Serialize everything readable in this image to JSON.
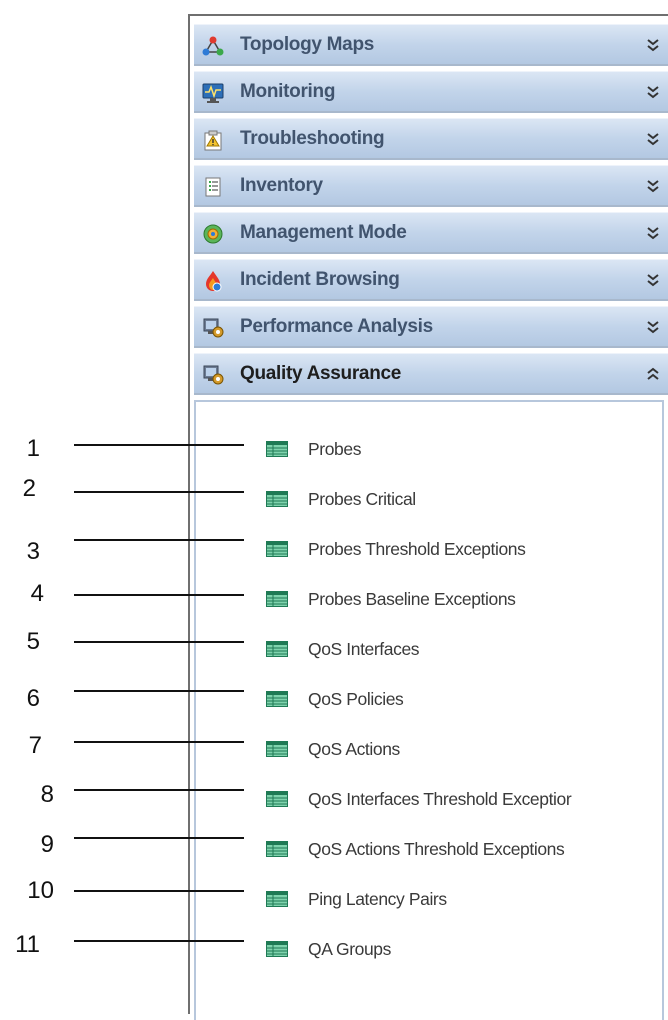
{
  "panel": {
    "headers": [
      {
        "label": "Topology Maps",
        "icon": "topology-icon"
      },
      {
        "label": "Monitoring",
        "icon": "monitor-icon"
      },
      {
        "label": "Troubleshooting",
        "icon": "troubleshooting-icon"
      },
      {
        "label": "Inventory",
        "icon": "inventory-icon"
      },
      {
        "label": "Management Mode",
        "icon": "management-mode-icon"
      },
      {
        "label": "Incident Browsing",
        "icon": "incident-icon"
      },
      {
        "label": "Performance Analysis",
        "icon": "performance-icon"
      },
      {
        "label": "Quality Assurance",
        "icon": "quality-assurance-icon",
        "expanded": true
      }
    ],
    "items": [
      {
        "label": "Probes"
      },
      {
        "label": "Probes Critical"
      },
      {
        "label": "Probes Threshold Exceptions"
      },
      {
        "label": "Probes Baseline Exceptions"
      },
      {
        "label": "QoS Interfaces"
      },
      {
        "label": "QoS Policies"
      },
      {
        "label": "QoS Actions"
      },
      {
        "label": "QoS Interfaces Threshold Exceptior"
      },
      {
        "label": "QoS Actions Threshold Exceptions"
      },
      {
        "label": "Ping Latency Pairs"
      },
      {
        "label": "QA Groups"
      }
    ]
  },
  "callouts": [
    "1",
    "2",
    "3",
    "4",
    "5",
    "6",
    "7",
    "8",
    "9",
    "10",
    "11"
  ],
  "colors": {
    "header_gradient_top": "#dbe6f4",
    "header_gradient_bottom": "#b3c8e2",
    "header_text": "#41546e",
    "item_icon": "#2fa07a"
  }
}
